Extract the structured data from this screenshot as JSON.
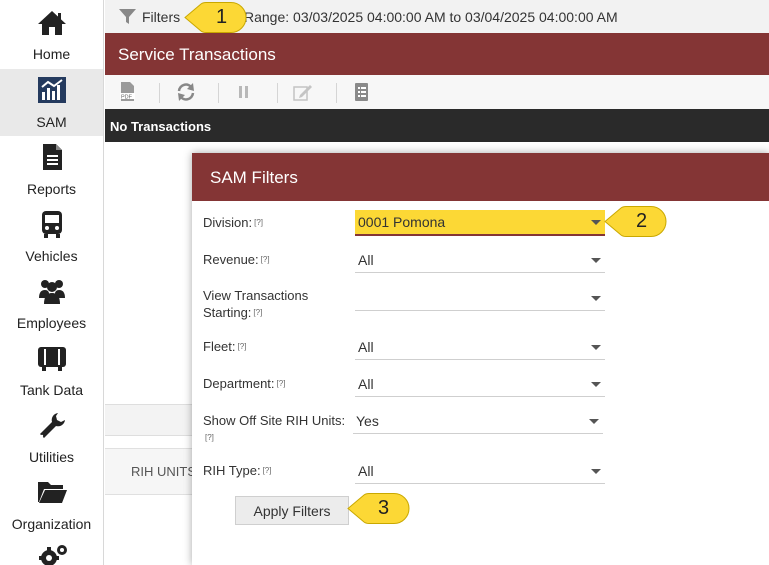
{
  "sidebar": {
    "items": [
      {
        "label": "Home",
        "icon": "home-icon"
      },
      {
        "label": "SAM",
        "icon": "chart-icon",
        "active": true
      },
      {
        "label": "Reports",
        "icon": "document-icon"
      },
      {
        "label": "Vehicles",
        "icon": "bus-icon"
      },
      {
        "label": "Employees",
        "icon": "group-icon"
      },
      {
        "label": "Tank Data",
        "icon": "tank-icon"
      },
      {
        "label": "Utilities",
        "icon": "wrench-icon"
      },
      {
        "label": "Organization",
        "icon": "folder-icon"
      }
    ]
  },
  "topbar": {
    "filters_label": "Filters",
    "range_text": "Range: 03/03/2025 04:00:00 AM to 03/04/2025 04:00:00 AM"
  },
  "header": {
    "title": "Service Transactions"
  },
  "toolbar": {
    "buttons": [
      "pdf-icon",
      "refresh-icon",
      "pause-icon",
      "edit-icon",
      "list-icon"
    ]
  },
  "status": {
    "text": "No Transactions"
  },
  "tabs": {
    "rih_units": "RIH UNITS"
  },
  "modal": {
    "title": "SAM Filters",
    "help_marker": "[?]",
    "fields": [
      {
        "label": "Division:",
        "value": "0001 Pomona"
      },
      {
        "label": "Revenue:",
        "value": "All"
      },
      {
        "label": "View Transactions Starting:",
        "value": ""
      },
      {
        "label": "Fleet:",
        "value": "All"
      },
      {
        "label": "Department:",
        "value": "All"
      },
      {
        "label": "Show Off Site RIH Units:",
        "value": "Yes"
      },
      {
        "label": "RIH Type:",
        "value": "All"
      }
    ],
    "apply_label": "Apply Filters"
  },
  "callouts": [
    "1",
    "2",
    "3"
  ],
  "colors": {
    "brand": "#843535",
    "highlight": "#fcd835",
    "status_bar": "#2a2a2a"
  }
}
